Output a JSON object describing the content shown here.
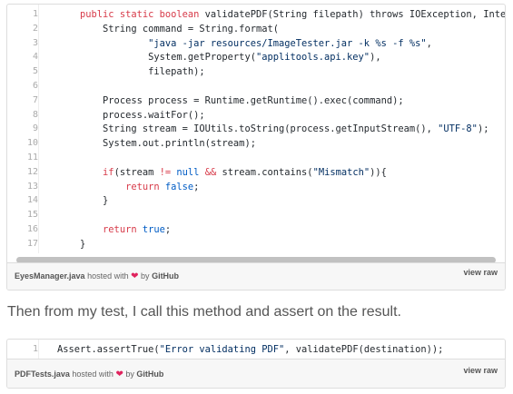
{
  "gist1": {
    "lines": [
      {
        "n": "1",
        "html": "    <span class='kw'>public static boolean</span> validatePDF(String filepath) throws IOException, InterruptedException {"
      },
      {
        "n": "2",
        "html": "        String command = String.format("
      },
      {
        "n": "3",
        "html": "                <span class='st'>\"java -jar resources/ImageTester.jar -k %s -f %s\"</span>,"
      },
      {
        "n": "4",
        "html": "                System.getProperty(<span class='st'>\"applitools.api.key\"</span>),"
      },
      {
        "n": "5",
        "html": "                filepath);"
      },
      {
        "n": "6",
        "html": ""
      },
      {
        "n": "7",
        "html": "        Process process = Runtime.getRuntime().exec(command);"
      },
      {
        "n": "8",
        "html": "        process.waitFor();"
      },
      {
        "n": "9",
        "html": "        String stream = IOUtils.toString(process.getInputStream(), <span class='st'>\"UTF-8\"</span>);"
      },
      {
        "n": "10",
        "html": "        System.out.println(stream);"
      },
      {
        "n": "11",
        "html": ""
      },
      {
        "n": "12",
        "html": "        <span class='kw'>if</span>(stream <span class='kw'>!=</span> <span class='bl'>null</span> <span class='kw'>&amp;&amp;</span> stream.contains(<span class='st'>\"Mismatch\"</span>)){"
      },
      {
        "n": "13",
        "html": "            <span class='kw'>return</span> <span class='bl'>false</span>;"
      },
      {
        "n": "14",
        "html": "        }"
      },
      {
        "n": "15",
        "html": ""
      },
      {
        "n": "16",
        "html": "        <span class='kw'>return</span> <span class='bl'>true</span>;"
      },
      {
        "n": "17",
        "html": "    }"
      }
    ],
    "meta": {
      "filename": "EyesManager.java",
      "hosted_with": "hosted with",
      "heart": "❤",
      "by": "by",
      "github": "GitHub",
      "view_raw": "view raw"
    }
  },
  "prose": "Then from my test, I call this method and assert on the result.",
  "gist2": {
    "lines": [
      {
        "n": "1",
        "html": "Assert.assertTrue(<span class='st'>\"Error validating PDF\"</span>, validatePDF(destination));"
      }
    ],
    "meta": {
      "filename": "PDFTests.java",
      "hosted_with": "hosted with",
      "heart": "❤",
      "by": "by",
      "github": "GitHub",
      "view_raw": "view raw"
    }
  }
}
